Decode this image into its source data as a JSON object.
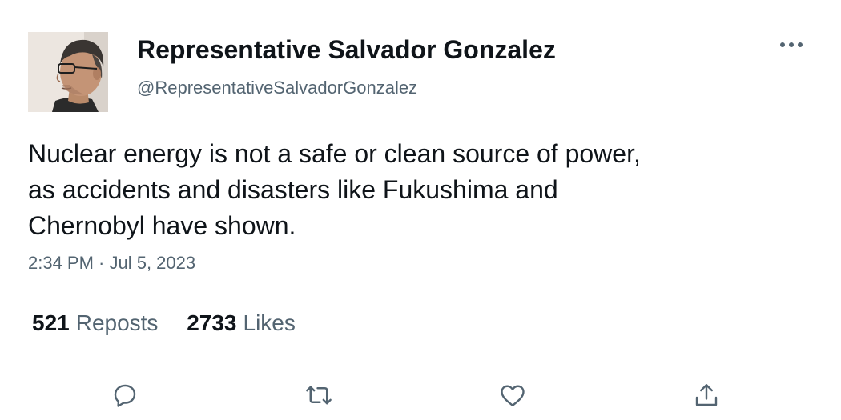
{
  "author": {
    "display_name": "Representative Salvador Gonzalez",
    "handle": "@RepresentativeSalvadorGonzalez"
  },
  "tweet": {
    "lines": [
      "Nuclear energy is not a safe or clean source of power,",
      "as accidents and disasters like Fukushima and",
      "Chernobyl have shown."
    ],
    "timestamp": "2:34 PM · Jul 5, 2023"
  },
  "stats": {
    "reposts_count": "521",
    "reposts_label": "Reposts",
    "likes_count": "2733",
    "likes_label": "Likes"
  },
  "actions": [
    "reply-icon",
    "repost-icon",
    "like-icon",
    "share-icon"
  ],
  "colors": {
    "text": "#0f1419",
    "secondary": "#536471",
    "divider": "#cfd9de",
    "icon": "#536471"
  }
}
